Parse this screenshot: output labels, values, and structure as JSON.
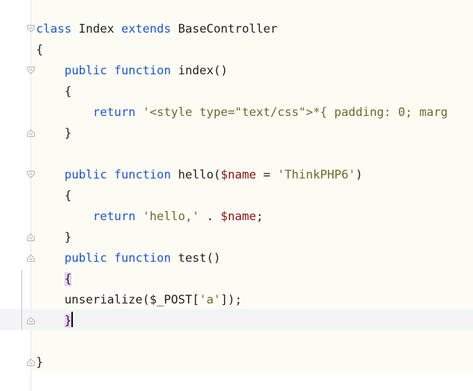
{
  "editor": {
    "caret_line": 15,
    "lines": [
      [
        {
          "t": "class",
          "c": "kw"
        },
        {
          "t": " Index "
        },
        {
          "t": "extends",
          "c": "kw"
        },
        {
          "t": " BaseController"
        }
      ],
      [
        {
          "t": "{"
        }
      ],
      [
        {
          "t": "    "
        },
        {
          "t": "public",
          "c": "kw"
        },
        {
          "t": " "
        },
        {
          "t": "function",
          "c": "kw"
        },
        {
          "t": " index()"
        }
      ],
      [
        {
          "t": "    {"
        }
      ],
      [
        {
          "t": "        "
        },
        {
          "t": "return",
          "c": "kw"
        },
        {
          "t": " "
        },
        {
          "t": "'<style type=\"text/css\">*{ padding: 0; marg",
          "c": "str"
        }
      ],
      [
        {
          "t": "    }"
        }
      ],
      [
        {
          "t": ""
        }
      ],
      [
        {
          "t": "    "
        },
        {
          "t": "public",
          "c": "kw"
        },
        {
          "t": " "
        },
        {
          "t": "function",
          "c": "kw"
        },
        {
          "t": " hello("
        },
        {
          "t": "$name",
          "c": "var"
        },
        {
          "t": " = "
        },
        {
          "t": "'ThinkPHP6'",
          "c": "str"
        },
        {
          "t": ")"
        }
      ],
      [
        {
          "t": "    {"
        }
      ],
      [
        {
          "t": "        "
        },
        {
          "t": "return",
          "c": "kw"
        },
        {
          "t": " "
        },
        {
          "t": "'hello,'",
          "c": "str"
        },
        {
          "t": " . "
        },
        {
          "t": "$name",
          "c": "var"
        },
        {
          "t": ";"
        }
      ],
      [
        {
          "t": "    }"
        }
      ],
      [
        {
          "t": "    "
        },
        {
          "t": "public",
          "c": "kw"
        },
        {
          "t": " "
        },
        {
          "t": "function",
          "c": "kw"
        },
        {
          "t": " test()"
        }
      ],
      [
        {
          "t": "    "
        },
        {
          "t": "{",
          "c": "brace"
        }
      ],
      [
        {
          "t": "    unserialize($_POST["
        },
        {
          "t": "'a'",
          "c": "str"
        },
        {
          "t": "]);"
        }
      ],
      [
        {
          "t": "    "
        },
        {
          "t": "}",
          "c": "brace"
        },
        {
          "t": "",
          "c": "caret"
        }
      ],
      [
        {
          "t": ""
        }
      ],
      [
        {
          "t": "}"
        }
      ]
    ],
    "fold_markers": [
      {
        "line": 1,
        "kind": "start"
      },
      {
        "line": 3,
        "kind": "start"
      },
      {
        "line": 6,
        "kind": "end"
      },
      {
        "line": 8,
        "kind": "start"
      },
      {
        "line": 11,
        "kind": "end"
      },
      {
        "line": 12,
        "kind": "end"
      },
      {
        "line": 15,
        "kind": "end"
      },
      {
        "line": 17,
        "kind": "end"
      }
    ]
  },
  "colors": {
    "editor_background": "#fdfcf4",
    "keyword": "#1d55c9",
    "string": "#6a6b2b",
    "variable": "#871212",
    "brace_highlight": "#e6d3f2",
    "caret_row": "#f3f4f5"
  },
  "icons": {
    "fold_start": "fold-collapse-icon",
    "fold_end": "fold-end-icon"
  }
}
